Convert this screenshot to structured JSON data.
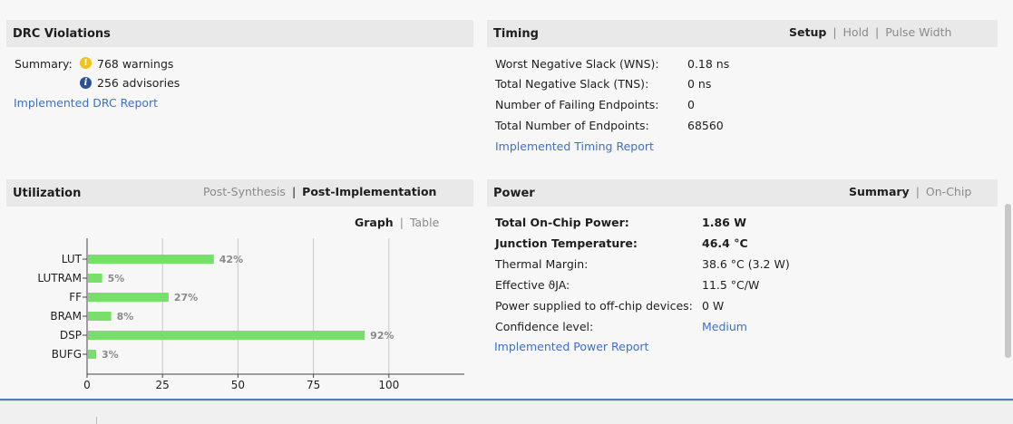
{
  "drc": {
    "title": "DRC Violations",
    "summary_label": "Summary:",
    "warnings": "768 warnings",
    "advisories": "256 advisories",
    "report_link": "Implemented DRC Report",
    "warn_icon": "warning-icon",
    "info_icon": "info-icon"
  },
  "timing": {
    "title": "Timing",
    "tabs": [
      {
        "label": "Setup",
        "active": true
      },
      {
        "label": "Hold",
        "active": false
      },
      {
        "label": "Pulse Width",
        "active": false
      }
    ],
    "rows": [
      {
        "label": "Worst Negative Slack (WNS):",
        "value": "0.18 ns"
      },
      {
        "label": "Total Negative Slack (TNS):",
        "value": "0 ns"
      },
      {
        "label": "Number of Failing Endpoints:",
        "value": "0"
      },
      {
        "label": "Total Number of Endpoints:",
        "value": "68560"
      }
    ],
    "report_link": "Implemented Timing Report"
  },
  "utilization": {
    "title": "Utilization",
    "tabs": [
      {
        "label": "Post-Synthesis",
        "active": false
      },
      {
        "label": "Post-Implementation",
        "active": true
      }
    ],
    "view_tabs": [
      {
        "label": "Graph",
        "active": true
      },
      {
        "label": "Table",
        "active": false
      }
    ]
  },
  "power": {
    "title": "Power",
    "tabs": [
      {
        "label": "Summary",
        "active": true
      },
      {
        "label": "On-Chip",
        "active": false
      }
    ],
    "rows": [
      {
        "label": "Total On-Chip Power:",
        "value": "1.86 W",
        "bold": true
      },
      {
        "label": "Junction Temperature:",
        "value": "46.4 °C",
        "bold": true
      },
      {
        "label": "Thermal Margin:",
        "value": "38.6 °C (3.2 W)",
        "bold": false
      },
      {
        "label": "Effective ϑJA:",
        "value": "11.5 °C/W",
        "bold": false
      },
      {
        "label": "Power supplied to off-chip devices:",
        "value": "0 W",
        "bold": false
      },
      {
        "label": "Confidence level:",
        "value": "Medium",
        "bold": false,
        "link": true
      }
    ],
    "report_link": "Implemented Power Report"
  },
  "colors": {
    "bar": "#77e06a",
    "link": "#3f6fc6",
    "header_bg": "#e9e9e9",
    "accent_line": "#4e7fc4"
  },
  "chart_data": {
    "type": "bar",
    "orientation": "horizontal",
    "categories": [
      "LUT",
      "LUTRAM",
      "FF",
      "BRAM",
      "DSP",
      "BUFG"
    ],
    "values": [
      42,
      5,
      27,
      8,
      92,
      3
    ],
    "value_labels": [
      "42%",
      "5%",
      "27%",
      "8%",
      "92%",
      "3%"
    ],
    "xticks": [
      0,
      25,
      50,
      75,
      100
    ],
    "xlim": [
      0,
      125
    ],
    "grid": true,
    "title": "",
    "xlabel": "",
    "ylabel": ""
  }
}
